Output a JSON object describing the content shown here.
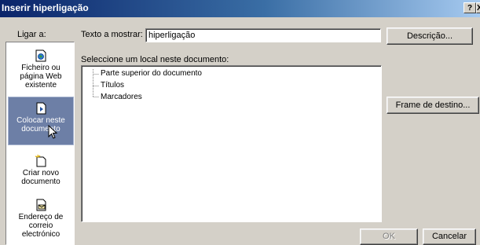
{
  "window": {
    "title": "Inserir hiperligação",
    "help_label": "?",
    "close_label": "X"
  },
  "link_to": {
    "label": "Ligar a:",
    "items": [
      {
        "label_1": "Ficheiro ou",
        "label_2": "página Web",
        "label_3": "existente",
        "icon": "web-page-icon"
      },
      {
        "label_1": "Colocar neste",
        "label_2": "documento",
        "icon": "document-place-icon"
      },
      {
        "label_1": "Criar novo",
        "label_2": "documento",
        "icon": "new-document-icon"
      },
      {
        "label_1": "Endereço de",
        "label_2": "correio",
        "label_3": "electrónico",
        "icon": "email-icon"
      }
    ]
  },
  "text_to_display": {
    "label": "Texto a mostrar:",
    "value": "hiperligação"
  },
  "description_button": "Descrição...",
  "select_place": {
    "label": "Seleccione um local neste documento:",
    "items": [
      "Parte superior do documento",
      "Títulos",
      "Marcadores"
    ]
  },
  "target_frame_button": "Frame de destino...",
  "ok_button": "OK",
  "cancel_button": "Cancelar"
}
